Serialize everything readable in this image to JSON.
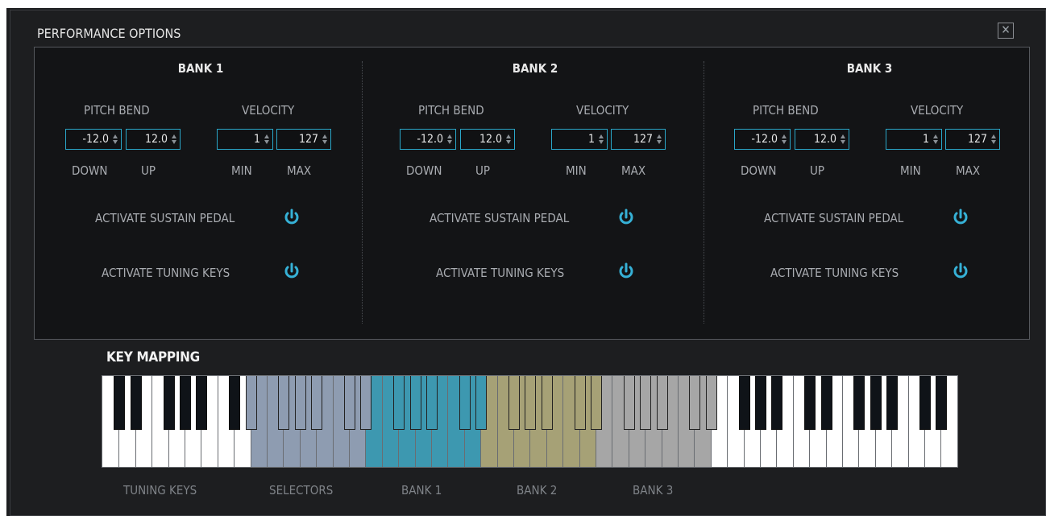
{
  "window": {
    "title": "PERFORMANCE OPTIONS",
    "close_label": "✕"
  },
  "banks": [
    {
      "title": "BANK 1",
      "pitch_bend_label": "PITCH BEND",
      "velocity_label": "VELOCITY",
      "pitch_down": "-12.0",
      "pitch_up": "12.0",
      "vel_min": "1",
      "vel_max": "127",
      "down_label": "DOWN",
      "up_label": "UP",
      "min_label": "MIN",
      "max_label": "MAX",
      "sustain_label": "ACTIVATE SUSTAIN PEDAL",
      "tuning_label": "ACTIVATE TUNING KEYS"
    },
    {
      "title": "BANK 2",
      "pitch_bend_label": "PITCH BEND",
      "velocity_label": "VELOCITY",
      "pitch_down": "-12.0",
      "pitch_up": "12.0",
      "vel_min": "1",
      "vel_max": "127",
      "down_label": "DOWN",
      "up_label": "UP",
      "min_label": "MIN",
      "max_label": "MAX",
      "sustain_label": "ACTIVATE SUSTAIN PEDAL",
      "tuning_label": "ACTIVATE TUNING KEYS"
    },
    {
      "title": "BANK 3",
      "pitch_bend_label": "PITCH BEND",
      "velocity_label": "VELOCITY",
      "pitch_down": "-12.0",
      "pitch_up": "12.0",
      "vel_min": "1",
      "vel_max": "127",
      "down_label": "DOWN",
      "up_label": "UP",
      "min_label": "MIN",
      "max_label": "MAX",
      "sustain_label": "ACTIVATE SUSTAIN PEDAL",
      "tuning_label": "ACTIVATE TUNING KEYS"
    }
  ],
  "key_mapping": {
    "title": "KEY MAPPING",
    "zones": [
      {
        "label": "TUNING KEYS",
        "color": "#ffffff",
        "black_color": "#0f1318"
      },
      {
        "label": "SELECTORS",
        "color": "#8e9cb1",
        "black_color": "#8e9cb1"
      },
      {
        "label": "BANK 1",
        "color": "#3d98b0",
        "black_color": "#3d98b0"
      },
      {
        "label": "BANK 2",
        "color": "#a6a176",
        "black_color": "#a6a176"
      },
      {
        "label": "BANK 3",
        "color": "#a6a6a6",
        "black_color": "#a6a6a6"
      }
    ]
  },
  "colors": {
    "background": "#1d1e20",
    "panel": "#131416",
    "accent": "#2aa6c8",
    "power_icon": "#36b1d6",
    "label": "#a9acb1",
    "default_white_key": "#ffffff",
    "default_black_key": "#0f1318"
  }
}
